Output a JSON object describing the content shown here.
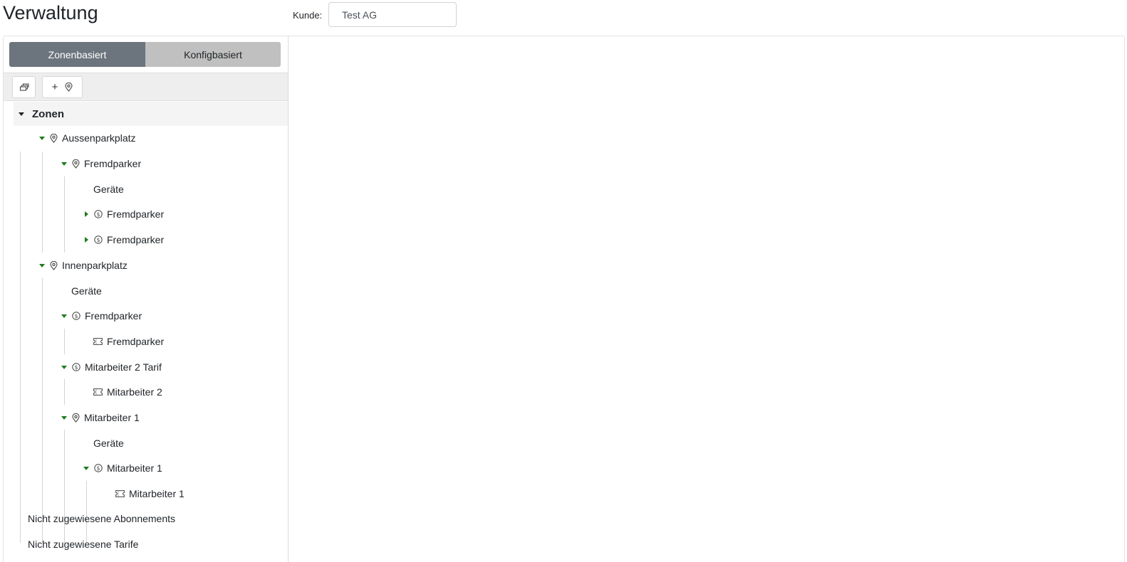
{
  "header": {
    "title": "Verwaltung",
    "customer_label": "Kunde:",
    "customer_value": "Test AG"
  },
  "mode_toggle": {
    "zone_based": "Zonenbasiert",
    "config_based": "Konfigbasiert",
    "active": "Zonenbasiert"
  },
  "toolbar": {
    "collapse_icon": "collapse-all-icon",
    "add_plus": "+",
    "add_icon": "location-pin-icon"
  },
  "tree": {
    "root_label": "Zonen",
    "nodes": [
      {
        "label": "Aussenparkplatz",
        "icon": "location-pin-icon",
        "expanded": true
      },
      {
        "label": "Fremdparker",
        "icon": "location-pin-icon",
        "expanded": true
      },
      {
        "label": "Geräte"
      },
      {
        "label": "Fremdparker",
        "icon": "tariff-coin-icon",
        "expanded": false
      },
      {
        "label": "Fremdparker",
        "icon": "tariff-coin-icon",
        "expanded": false
      },
      {
        "label": "Innenparkplatz",
        "icon": "location-pin-icon",
        "expanded": true
      },
      {
        "label": "Geräte"
      },
      {
        "label": "Fremdparker",
        "icon": "tariff-coin-icon",
        "expanded": true
      },
      {
        "label": "Fremdparker",
        "icon": "ticket-icon"
      },
      {
        "label": "Mitarbeiter 2 Tarif",
        "icon": "tariff-coin-icon",
        "expanded": true
      },
      {
        "label": "Mitarbeiter 2",
        "icon": "ticket-icon"
      },
      {
        "label": "Mitarbeiter 1",
        "icon": "location-pin-icon",
        "expanded": true
      },
      {
        "label": "Geräte"
      },
      {
        "label": "Mitarbeiter 1",
        "icon": "tariff-coin-icon",
        "expanded": true
      },
      {
        "label": "Mitarbeiter 1",
        "icon": "ticket-icon"
      }
    ]
  },
  "unassigned": {
    "subscriptions": "Nicht zugewiesene Abonnements",
    "tariffs": "Nicht zugewiesene Tarife"
  },
  "colors": {
    "toggle_active": "#6c757d",
    "toggle_inactive": "#c0c0c0",
    "caret_green": "#1e7b1e"
  }
}
